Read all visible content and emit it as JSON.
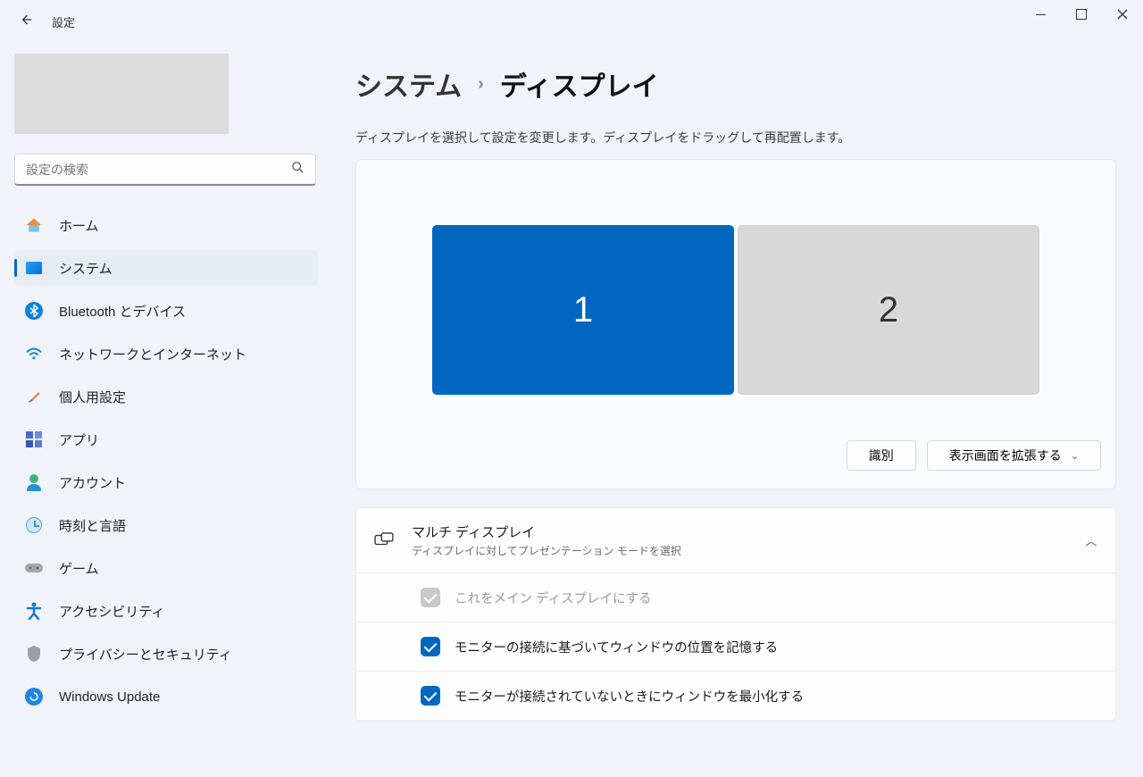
{
  "window": {
    "title": "設定"
  },
  "search": {
    "placeholder": "設定の検索"
  },
  "sidebar": {
    "items": [
      {
        "label": "ホーム",
        "name": "sidebar-item-home",
        "active": false
      },
      {
        "label": "システム",
        "name": "sidebar-item-system",
        "active": true
      },
      {
        "label": "Bluetooth とデバイス",
        "name": "sidebar-item-bluetooth",
        "active": false
      },
      {
        "label": "ネットワークとインターネット",
        "name": "sidebar-item-network",
        "active": false
      },
      {
        "label": "個人用設定",
        "name": "sidebar-item-personalization",
        "active": false
      },
      {
        "label": "アプリ",
        "name": "sidebar-item-apps",
        "active": false
      },
      {
        "label": "アカウント",
        "name": "sidebar-item-accounts",
        "active": false
      },
      {
        "label": "時刻と言語",
        "name": "sidebar-item-time-language",
        "active": false
      },
      {
        "label": "ゲーム",
        "name": "sidebar-item-gaming",
        "active": false
      },
      {
        "label": "アクセシビリティ",
        "name": "sidebar-item-accessibility",
        "active": false
      },
      {
        "label": "プライバシーとセキュリティ",
        "name": "sidebar-item-privacy",
        "active": false
      },
      {
        "label": "Windows Update",
        "name": "sidebar-item-windows-update",
        "active": false
      }
    ]
  },
  "breadcrumb": {
    "parent": "システム",
    "current": "ディスプレイ"
  },
  "main": {
    "helper_text": "ディスプレイを選択して設定を変更します。ディスプレイをドラッグして再配置します。",
    "monitors": [
      {
        "label": "1",
        "selected": true
      },
      {
        "label": "2",
        "selected": false
      }
    ],
    "identify_label": "識別",
    "projection_mode": {
      "label": "表示画面を拡張する"
    },
    "multi_display": {
      "title": "マルチ ディスプレイ",
      "description": "ディスプレイに対してプレゼンテーション モードを選択",
      "options": [
        {
          "label": "これをメイン ディスプレイにする",
          "checked": true,
          "disabled": true
        },
        {
          "label": "モニターの接続に基づいてウィンドウの位置を記憶する",
          "checked": true,
          "disabled": false
        },
        {
          "label": "モニターが接続されていないときにウィンドウを最小化する",
          "checked": true,
          "disabled": false
        }
      ]
    }
  }
}
